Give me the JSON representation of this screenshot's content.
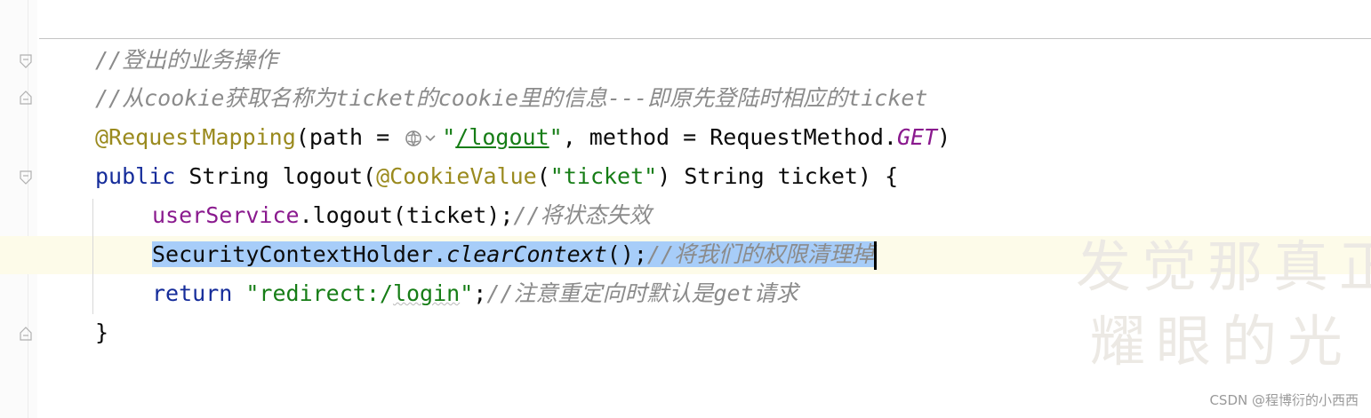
{
  "editor": {
    "lines": [
      {
        "id": "l1",
        "parts": [
          {
            "t": "//登出的业务操作",
            "c": "comment"
          }
        ]
      },
      {
        "id": "l2",
        "parts": [
          {
            "t": "//从cookie获取名称为ticket的cookie里的信息---即原先登陆时相应的ticket",
            "c": "comment"
          }
        ]
      },
      {
        "id": "l3",
        "parts": [
          {
            "t": "@RequestMapping",
            "c": "annot"
          },
          {
            "t": "(path = ",
            "c": ""
          },
          {
            "t": "\"",
            "c": "str"
          },
          {
            "t": "/logout",
            "c": "str url"
          },
          {
            "t": "\"",
            "c": "str"
          },
          {
            "t": ", method = RequestMethod.",
            "c": ""
          },
          {
            "t": "GET",
            "c": "field ital"
          },
          {
            "t": ")",
            "c": ""
          }
        ]
      },
      {
        "id": "l4",
        "parts": [
          {
            "t": "public",
            "c": "kw"
          },
          {
            "t": " String ",
            "c": ""
          },
          {
            "t": "logout",
            "c": "method"
          },
          {
            "t": "(",
            "c": ""
          },
          {
            "t": "@CookieValue",
            "c": "annot"
          },
          {
            "t": "(",
            "c": ""
          },
          {
            "t": "\"ticket\"",
            "c": "str"
          },
          {
            "t": ") String ticket) {",
            "c": ""
          }
        ]
      },
      {
        "id": "l5",
        "parts": [
          {
            "t": "userService",
            "c": "field"
          },
          {
            "t": ".logout(ticket);",
            "c": ""
          },
          {
            "t": "//将状态失效",
            "c": "comment"
          }
        ]
      },
      {
        "id": "l6",
        "parts": [
          {
            "t": "SecurityContextHolder.",
            "c": "sel"
          },
          {
            "t": "clearContext",
            "c": "sel ital"
          },
          {
            "t": "();",
            "c": "sel"
          },
          {
            "t": "//将我们的权限清理掉",
            "c": "sel comment"
          }
        ]
      },
      {
        "id": "l7",
        "parts": [
          {
            "t": "return",
            "c": "kw"
          },
          {
            "t": " ",
            "c": ""
          },
          {
            "t": "\"redirect:/",
            "c": "str"
          },
          {
            "t": "login",
            "c": "str squiggle"
          },
          {
            "t": "\"",
            "c": "str"
          },
          {
            "t": ";",
            "c": ""
          },
          {
            "t": "//注意重定向时默认是get请求",
            "c": "comment"
          }
        ]
      },
      {
        "id": "l8",
        "parts": [
          {
            "t": "}",
            "c": ""
          }
        ]
      }
    ]
  },
  "watermark": {
    "line1": "发觉那真正",
    "line2": "耀眼的光"
  },
  "credit": "CSDN @程博衍的小西西",
  "icons": {
    "fold_marker": "fold-marker-icon",
    "web_endpoint": "globe-icon"
  },
  "colors": {
    "keyword": "#152c9a",
    "annotation": "#9a8a1e",
    "string": "#167d16",
    "comment": "#8b8b8b",
    "field": "#8a1a8e",
    "selection": "#a7cdf9"
  }
}
